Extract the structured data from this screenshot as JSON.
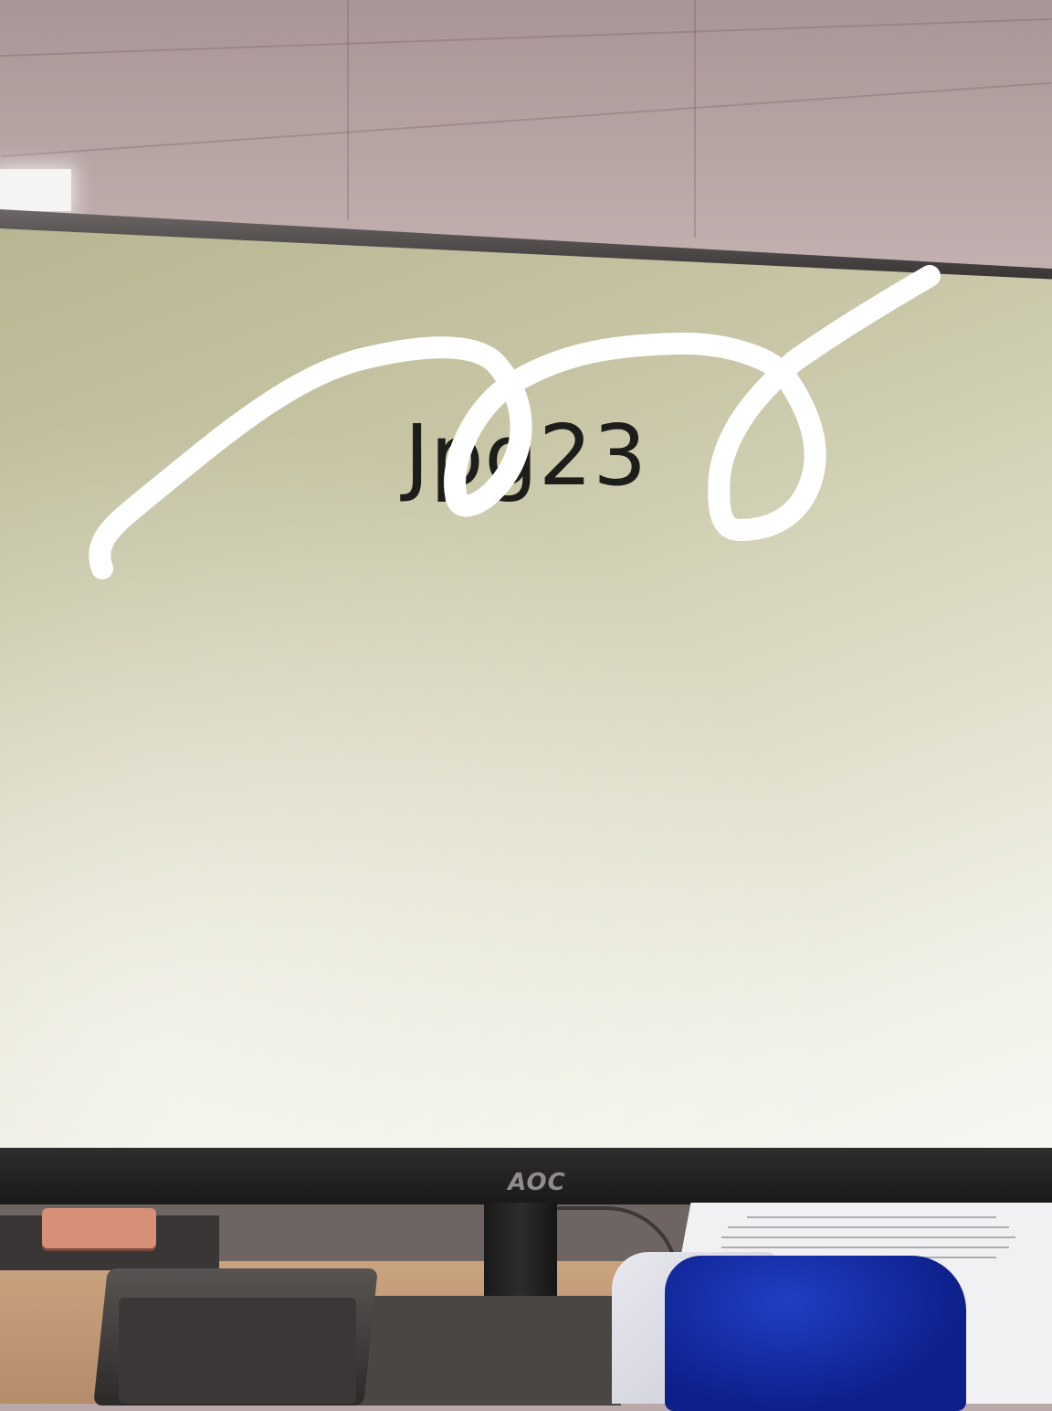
{
  "screen": {
    "title": "Jpg23"
  },
  "monitor": {
    "brand": "AOC"
  },
  "scribble": {
    "color": "#ffffff"
  },
  "colors": {
    "screen_top": "#b8b592",
    "screen_bottom": "#f7f7f3",
    "bezel": "#1a1919",
    "ceiling": "#b8a6a5",
    "desk": "#c9a27e",
    "blue_pouch": "#1f3fc4"
  }
}
